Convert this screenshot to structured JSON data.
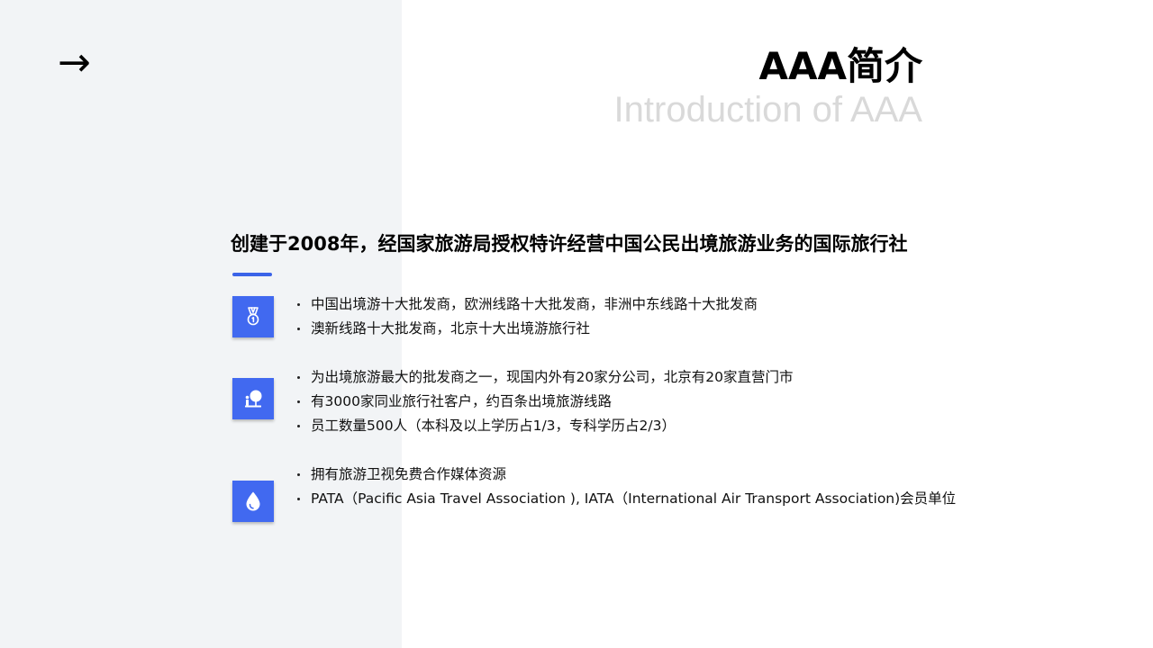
{
  "nav": {
    "arrow": "→"
  },
  "header": {
    "title": "AAA简介",
    "subtitle": "Introduction of AAA"
  },
  "intro": {
    "headline": "创建于2008年，经国家旅游局授权特许经营中国公民出境旅游业务的国际旅行社"
  },
  "theme": {
    "accent": "#4169f0",
    "left_panel_bg": "#f2f4f6",
    "subtitle_color": "#d9d9d9"
  },
  "groups": [
    {
      "icon": "medal-icon",
      "items": [
        "中国出境游十大批发商，欧洲线路十大批发商，非洲中东线路十大批发商",
        "澳新线路十大批发商，北京十大出境游旅行社"
      ]
    },
    {
      "icon": "presenter-icon",
      "items": [
        "为出境旅游最大的批发商之一，现国内外有20家分公司，北京有20家直营门市",
        "有3000家同业旅行社客户，约百条出境旅游线路",
        "员工数量500人（本科及以上学历占1/3，专科学历占2/3）"
      ]
    },
    {
      "icon": "water-drop-icon",
      "items": [
        "拥有旅游卫视免费合作媒体资源",
        "PATA（Pacific Asia Travel Association ), IATA（International Air Transport Association)会员单位"
      ]
    }
  ]
}
